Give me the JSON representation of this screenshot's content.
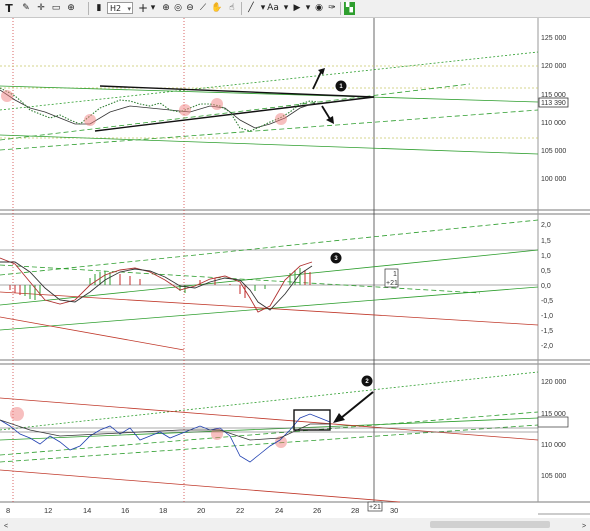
{
  "toolbar": {
    "timeframe": "H2",
    "text_tool": "T",
    "font_tool": "Aa"
  },
  "main_panel": {
    "price_labels": [
      "125 000",
      "120 000",
      "115 000",
      "110 000",
      "105 000",
      "100 000"
    ],
    "current_price": "113 390",
    "badge": "1"
  },
  "oscillator_panel": {
    "labels": [
      "2,0",
      "1,5",
      "1,0",
      "0,5",
      "0,0",
      "-0,5",
      "-1,0",
      "-1,5",
      "-2,0"
    ],
    "badge": "3",
    "box_top": "1",
    "box_bottom": "+21"
  },
  "bottom_panel": {
    "price_labels": [
      "120 000",
      "115 000",
      "110 000",
      "105 000"
    ],
    "badge": "2"
  },
  "time_axis": {
    "labels": [
      "8",
      "12",
      "14",
      "16",
      "18",
      "20",
      "22",
      "24",
      "26",
      "28",
      "30"
    ],
    "cursor_label": "+21"
  },
  "colors": {
    "candle_up": "#2e7d32",
    "candle_down": "#c62828",
    "trend_green": "#2e9e2e",
    "trend_red": "#c0392b",
    "line_blue": "#1f3fb0",
    "highlight": "#f08080"
  }
}
